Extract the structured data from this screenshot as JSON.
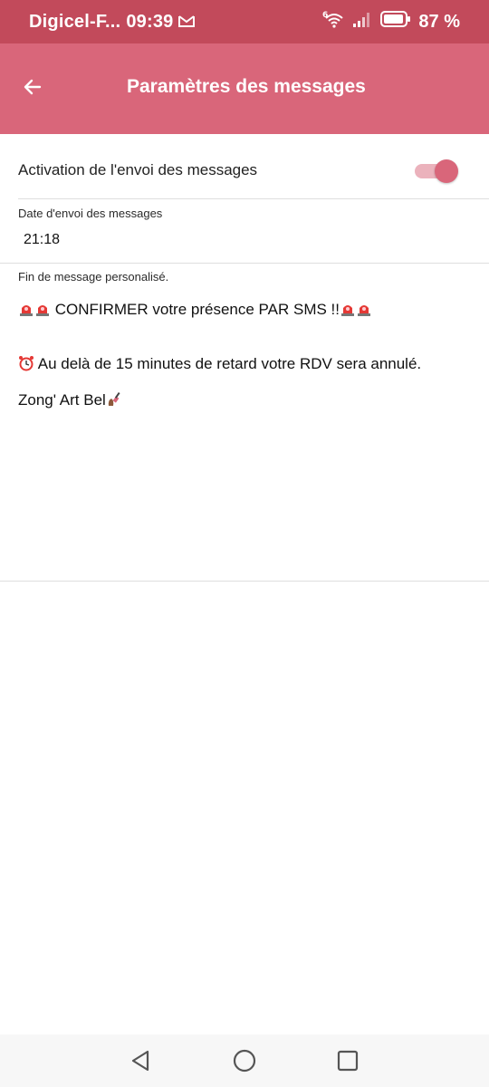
{
  "status_bar": {
    "carrier": "Digicel-F...",
    "time": "09:39",
    "battery": "87 %",
    "gmail_icon": "gmail-icon",
    "wifi_icon": "wifi-icon",
    "signal_icon": "signal-icon",
    "battery_icon": "battery-icon"
  },
  "app_bar": {
    "title": "Paramètres des messages",
    "back_icon": "arrow-left-icon"
  },
  "toggle": {
    "label": "Activation de l'envoi des messages",
    "enabled": true
  },
  "date": {
    "label": "Date d'envoi des messages",
    "value": "21:18"
  },
  "custom_message": {
    "label": "Fin de message personalisé.",
    "line1": " CONFIRMER votre présence PAR SMS !!",
    "line2": " Au delà de 15 minutes de retard votre RDV sera annulé.",
    "line3": "Zong' Art Bel"
  },
  "nav_bar": {
    "back_icon": "triangle-back-icon",
    "home_icon": "circle-home-icon",
    "recents_icon": "square-recents-icon"
  },
  "colors": {
    "status_bar": "#c24a5b",
    "app_bar": "#d9667a",
    "switch_track": "#ebb2bc"
  }
}
